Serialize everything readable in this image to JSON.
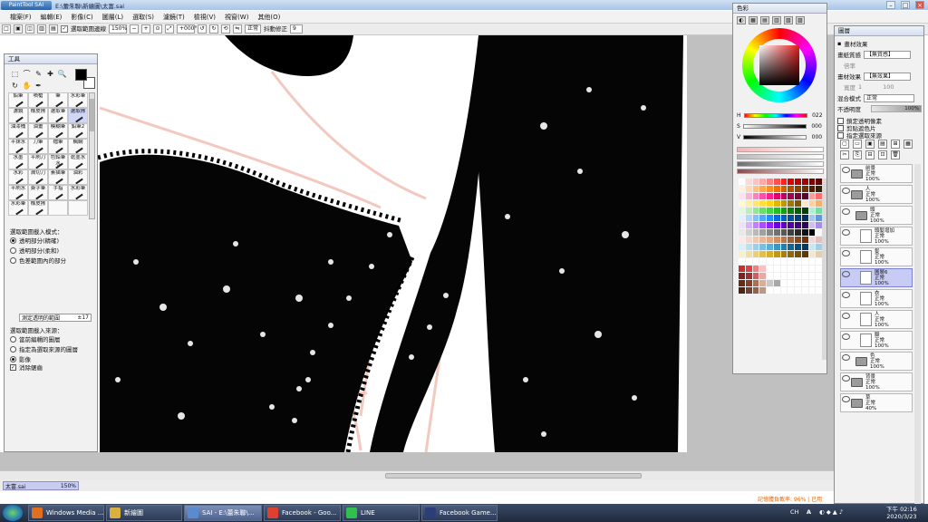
{
  "window": {
    "logo": "PaintTool SAI",
    "title": "E:\\蕾朱聯\\新繪圖\\太富.sai",
    "minimize": "–",
    "maximize": "□",
    "close": "×"
  },
  "menu": [
    "檔案(F)",
    "編輯(E)",
    "影像(C)",
    "圖層(L)",
    "選取(S)",
    "濾鏡(T)",
    "檢視(V)",
    "視窗(W)",
    "其他(O)"
  ],
  "toolbar": {
    "check_label": "選取範圍邊線",
    "zoom": "150%",
    "angle": "+000°",
    "mode": "正常",
    "stabilizer_label": "抖動修正",
    "stabilizer_value": "9"
  },
  "tool_panel": {
    "title": "工具",
    "tools": [
      "⬚",
      "⌒",
      "✎",
      "✚",
      "🔍",
      "↻",
      "✋",
      "✒"
    ],
    "brushes": [
      {
        "label": "鉛筆"
      },
      {
        "label": "噴槍"
      },
      {
        "label": "筆"
      },
      {
        "label": "水彩筆"
      },
      {
        "label": "濾鏡"
      },
      {
        "label": "橡皮擦"
      },
      {
        "label": "選取筆"
      },
      {
        "label": "選取擦"
      },
      {
        "label": "油漆桶"
      },
      {
        "label": "油畫"
      },
      {
        "label": "模糊筆"
      },
      {
        "label": "鉛筆2"
      },
      {
        "label": "平抹水"
      },
      {
        "label": "刀筆"
      },
      {
        "label": "檔筆"
      },
      {
        "label": "楓網"
      },
      {
        "label": "水墨"
      },
      {
        "label": "平刷刀"
      },
      {
        "label": "色鉛筆水"
      },
      {
        "label": "乾墨水"
      },
      {
        "label": "水彩"
      },
      {
        "label": "潤切刀"
      },
      {
        "label": "素描筆"
      },
      {
        "label": "油彩"
      },
      {
        "label": "平刷水"
      },
      {
        "label": "簽字筆"
      },
      {
        "label": "手指"
      },
      {
        "label": "水彩筆"
      },
      {
        "label": "水彩筆"
      },
      {
        "label": "橡皮擦"
      },
      {
        "label": ""
      },
      {
        "label": ""
      }
    ],
    "selected_brush": 7,
    "options_title": "選取範圍載入模式：",
    "mode_options": [
      "透明部分(精確)",
      "透明部分(柔和)",
      "色差範圍內的部分"
    ],
    "mode_selected": 0,
    "range_label": "測定透明的範圍",
    "range_value": "±17",
    "source_title": "選取範圍載入來源：",
    "source_options": [
      "當前編輯的圖層",
      "指定為選取來源的圖層",
      "影像"
    ],
    "source_selected": 2,
    "antialias_label": "消除鋸齒",
    "antialias_checked": true
  },
  "color_panel": {
    "title": "色彩",
    "tabs": [
      "◐",
      "▦",
      "▤",
      "▥",
      "▧",
      "▨"
    ],
    "h_label": "H",
    "h_value": "022",
    "s_label": "S",
    "s_value": "000",
    "v_label": "V",
    "v_value": "000",
    "mix_colors": [
      "#f5b5b5",
      "#b9b9b9",
      "#6e6e6e",
      "#8c4a4a"
    ],
    "palette": [
      "#ffffff",
      "#ffd8d8",
      "#ffc0c0",
      "#ffa8a8",
      "#ff8080",
      "#ff5050",
      "#ff2020",
      "#e00000",
      "#c00000",
      "#a00000",
      "#800000",
      "#600000",
      "#fff0e0",
      "#ffd8b0",
      "#ffc080",
      "#ffa850",
      "#ff9020",
      "#f07000",
      "#d06000",
      "#b05000",
      "#904000",
      "#703000",
      "#502000",
      "#302010",
      "#ffe0f0",
      "#ffb0d8",
      "#ff80c0",
      "#ff50a8",
      "#ff2090",
      "#e00070",
      "#c00060",
      "#a00050",
      "#800040",
      "#600030",
      "#ff9d9d",
      "#ff6d6d",
      "#fff8d0",
      "#fff0a0",
      "#ffe870",
      "#ffe040",
      "#ffd810",
      "#e0b800",
      "#c09800",
      "#a07800",
      "#805800",
      "#ffe8c8",
      "#ffd0a0",
      "#f0b070",
      "#e0f8e0",
      "#b8f0b8",
      "#90e890",
      "#68e068",
      "#40d840",
      "#20c020",
      "#10a010",
      "#088008",
      "#006000",
      "#004000",
      "#b0f0d0",
      "#70e0a0",
      "#e0f0ff",
      "#b0d8ff",
      "#80c0ff",
      "#50a8ff",
      "#2090ff",
      "#0070e0",
      "#0060c0",
      "#0050a0",
      "#004080",
      "#003060",
      "#a0c8f0",
      "#6098d8",
      "#f0e0ff",
      "#d8b0ff",
      "#c080ff",
      "#a850ff",
      "#9020ff",
      "#7000e0",
      "#6000c0",
      "#5000a0",
      "#400080",
      "#300060",
      "#d0c0f0",
      "#a890e0",
      "#e8e8e8",
      "#d0d0d0",
      "#b8b8b8",
      "#a0a0a0",
      "#888888",
      "#707070",
      "#585858",
      "#404040",
      "#282828",
      "#101010",
      "#000000",
      "#f8f8f8",
      "#ffe8e8",
      "#f8d8c8",
      "#f0c8b0",
      "#e8b898",
      "#e0a880",
      "#d09060",
      "#b87848",
      "#a06030",
      "#884818",
      "#703000",
      "#f0d8d8",
      "#e0c0c0",
      "#d8f0f8",
      "#b8e0f0",
      "#98d0e8",
      "#78c0e0",
      "#58b0d8",
      "#3898c8",
      "#2080b0",
      "#106898",
      "#005080",
      "#003868",
      "#c8e8f0",
      "#a0d0e0",
      "#f8f0c8",
      "#f0e0a0",
      "#e8d078",
      "#e0c050",
      "#d8b028",
      "#c09818",
      "#a88010",
      "#906808",
      "#785000",
      "#603800",
      "#f0e8d0",
      "#e0d0b0",
      "#ffffff",
      "#ffffff",
      "#ffffff",
      "#ffffff",
      "#ffffff",
      "#ffffff",
      "#ffffff",
      "#ffffff",
      "#ffffff",
      "#ffffff",
      "#ffffff",
      "#ffffff",
      "#c83030",
      "#e04040",
      "#f08080",
      "#f8c0c0",
      "#ffffff",
      "#ffffff",
      "#ffffff",
      "#ffffff",
      "#ffffff",
      "#ffffff",
      "#ffffff",
      "#ffffff",
      "#802020",
      "#a03030",
      "#d06060",
      "#e8a8a8",
      "#ffffff",
      "#ffffff",
      "#ffffff",
      "#ffffff",
      "#ffffff",
      "#ffffff",
      "#ffffff",
      "#ffffff",
      "#6a2a10",
      "#8a4020",
      "#b07050",
      "#d8b098",
      "#c8c8c8",
      "#a8a8a8",
      "#ffffff",
      "#ffffff",
      "#ffffff",
      "#ffffff",
      "#ffffff",
      "#ffffff",
      "#502010",
      "#704030",
      "#906050",
      "#b89888",
      "#ffffff",
      "#ffffff",
      "#ffffff",
      "#ffffff",
      "#ffffff",
      "#ffffff",
      "#ffffff",
      "#ffffff"
    ]
  },
  "layer_panel": {
    "title": "圖層",
    "effect_title": "畫材效果",
    "texture_label": "畫紙質感",
    "texture_value": "【無質感】",
    "texture_sub_label": "倍率",
    "effect_label": "畫材效果",
    "effect_value": "【無效果】",
    "effect_sub_label": "寬度",
    "effect_sub_value": "1",
    "effect_sub_value2": "100",
    "blend_label": "混合模式",
    "blend_value": "正常",
    "opacity_label": "不透明度",
    "opacity_value": "100%",
    "checks": [
      "鎖定透明像素",
      "剪貼遮色片",
      "指定選取來源"
    ],
    "icons": [
      "▢",
      "▭",
      "▣",
      "▤",
      "⊞",
      "▦",
      "✂",
      "⎘",
      "⊟",
      "⊡",
      "🗑"
    ],
    "layers": [
      {
        "name": "前景",
        "mode": "正常",
        "opacity": "100%",
        "type": "folder",
        "indent": 0,
        "selected": false
      },
      {
        "name": "人",
        "mode": "正常",
        "opacity": "100%",
        "type": "folder",
        "indent": 0,
        "selected": false
      },
      {
        "name": "頭",
        "mode": "正常",
        "opacity": "100%",
        "type": "folder",
        "indent": 1,
        "selected": false
      },
      {
        "name": "頭髮增加",
        "mode": "正常",
        "opacity": "100%",
        "type": "layer",
        "indent": 2,
        "selected": false
      },
      {
        "name": "髮",
        "mode": "正常",
        "opacity": "100%",
        "type": "layer",
        "indent": 2,
        "selected": false
      },
      {
        "name": "圖層6",
        "mode": "正常",
        "opacity": "100%",
        "type": "layer",
        "indent": 2,
        "selected": true
      },
      {
        "name": "衣",
        "mode": "正常",
        "opacity": "100%",
        "type": "layer",
        "indent": 2,
        "selected": false
      },
      {
        "name": "人",
        "mode": "正常",
        "opacity": "100%",
        "type": "layer",
        "indent": 2,
        "selected": false
      },
      {
        "name": "腳",
        "mode": "正常",
        "opacity": "100%",
        "type": "layer",
        "indent": 2,
        "selected": false
      },
      {
        "name": "色",
        "mode": "正常",
        "opacity": "100%",
        "type": "folder",
        "indent": 1,
        "selected": false
      },
      {
        "name": "背景",
        "mode": "正常",
        "opacity": "100%",
        "type": "folder",
        "indent": 0,
        "selected": false
      },
      {
        "name": "草",
        "mode": "正常",
        "opacity": "40%",
        "type": "folder",
        "indent": 0,
        "selected": false
      }
    ]
  },
  "navigator": {
    "file": "太富.sai",
    "zoom": "150%"
  },
  "status_warning": "記憶體負載率: 96% | 已用",
  "taskbar": {
    "tasks": [
      {
        "label": "Windows Media ...",
        "color": "#e07020",
        "active": false
      },
      {
        "label": "新繪圖",
        "color": "#d8b040",
        "active": false
      },
      {
        "label": "SAI - E:\\蕾朱聯\\...",
        "color": "#5a8ad0",
        "active": true
      },
      {
        "label": "Facebook - Goo...",
        "color": "#e04030",
        "active": false
      },
      {
        "label": "LINE",
        "color": "#30c050",
        "active": false
      },
      {
        "label": "Facebook Game...",
        "color": "#2b3e7a",
        "active": false
      }
    ],
    "tray_lang": "CH",
    "tray_a": "A",
    "time_period": "下午",
    "time": "02:16",
    "date": "2020/3/23"
  }
}
